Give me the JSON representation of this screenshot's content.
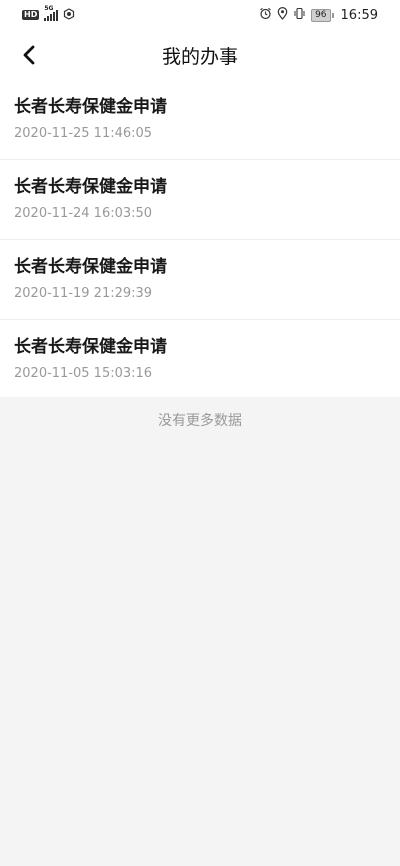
{
  "status_bar": {
    "hd": "HD",
    "network": "5G",
    "battery": "96",
    "time": "16:59",
    "icons": [
      "signal-icon",
      "vpn-icon",
      "alarm-icon",
      "location-icon",
      "vibrate-icon",
      "battery-icon"
    ]
  },
  "nav": {
    "title": "我的办事",
    "back_icon": "chevron-left-icon"
  },
  "items": [
    {
      "title": "长者长寿保健金申请",
      "date": "2020-11-25 11:46:05"
    },
    {
      "title": "长者长寿保健金申请",
      "date": "2020-11-24 16:03:50"
    },
    {
      "title": "长者长寿保健金申请",
      "date": "2020-11-19 21:29:39"
    },
    {
      "title": "长者长寿保健金申请",
      "date": "2020-11-05 15:03:16"
    }
  ],
  "footer": {
    "no_more": "没有更多数据"
  },
  "colors": {
    "background": "#f4f4f4",
    "card": "#ffffff",
    "title_text": "#1a1a1a",
    "secondary_text": "#999999"
  }
}
